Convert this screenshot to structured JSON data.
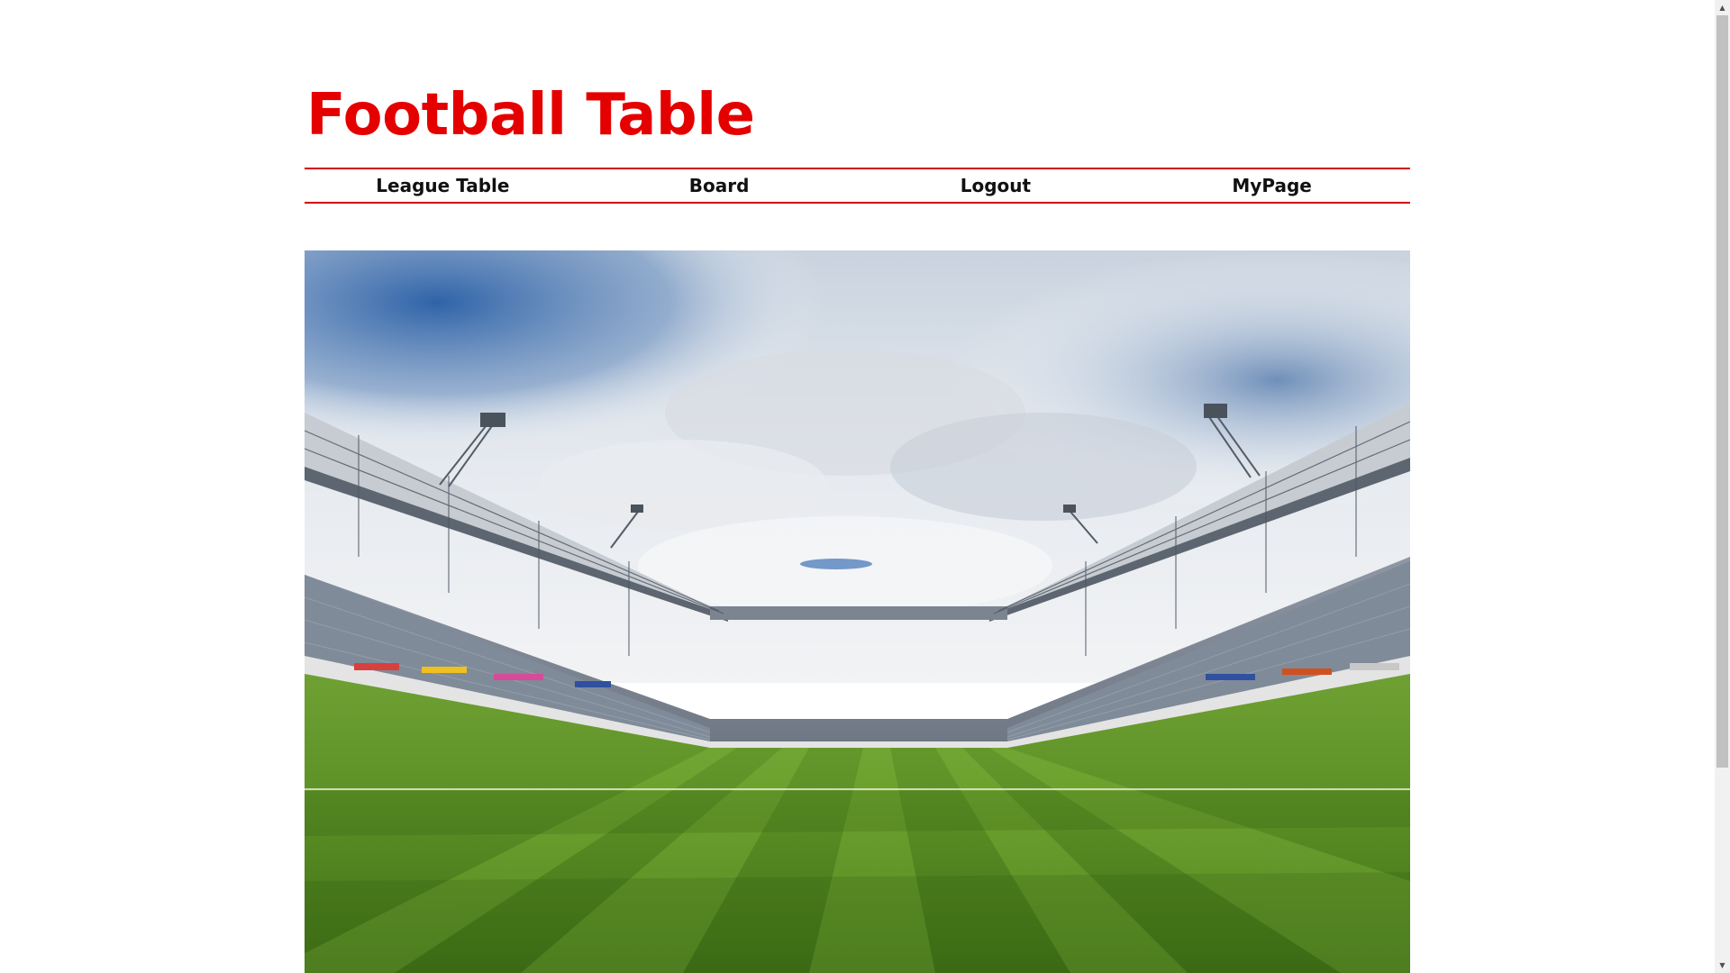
{
  "header": {
    "title": "Football Table"
  },
  "nav": {
    "items": [
      {
        "label": "League Table"
      },
      {
        "label": "Board"
      },
      {
        "label": "Logout"
      },
      {
        "label": "MyPage"
      }
    ]
  },
  "hero": {
    "image": "stadium-photo"
  },
  "colors": {
    "accent": "#e50000",
    "nav_border": "#d40000"
  },
  "scrollbar": {
    "up_icon": "chevron-up-icon",
    "down_icon": "chevron-down-icon"
  }
}
